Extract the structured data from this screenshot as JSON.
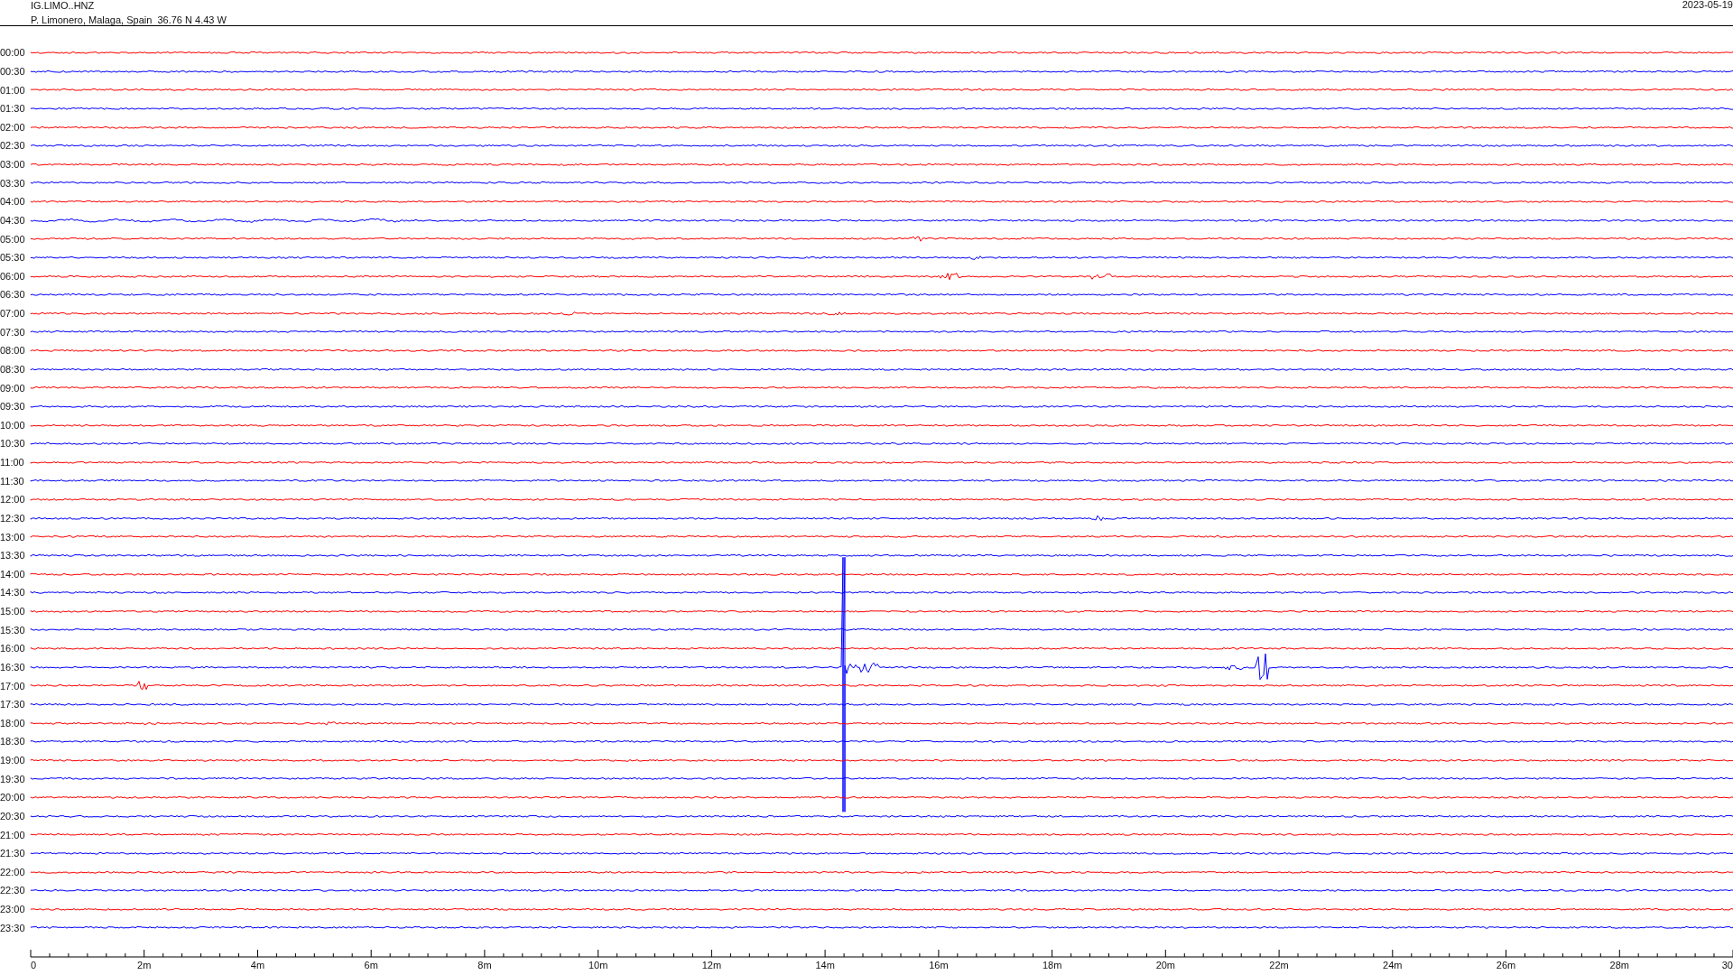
{
  "header": {
    "station": "IG.LIMO..HNZ",
    "location": "P. Limonero, Malaga, Spain  36.76 N 4.43 W",
    "date": "2023-05-19"
  },
  "rows": [
    {
      "time": "00:00",
      "color": "#ff0000"
    },
    {
      "time": "00:30",
      "color": "#0000ff"
    },
    {
      "time": "01:00",
      "color": "#ff0000"
    },
    {
      "time": "01:30",
      "color": "#0000ff"
    },
    {
      "time": "02:00",
      "color": "#ff0000"
    },
    {
      "time": "02:30",
      "color": "#0000ff"
    },
    {
      "time": "03:00",
      "color": "#ff0000"
    },
    {
      "time": "03:30",
      "color": "#0000ff"
    },
    {
      "time": "04:00",
      "color": "#ff0000"
    },
    {
      "time": "04:30",
      "color": "#0000ff"
    },
    {
      "time": "05:00",
      "color": "#ff0000"
    },
    {
      "time": "05:30",
      "color": "#0000ff"
    },
    {
      "time": "06:00",
      "color": "#ff0000"
    },
    {
      "time": "06:30",
      "color": "#0000ff"
    },
    {
      "time": "07:00",
      "color": "#ff0000"
    },
    {
      "time": "07:30",
      "color": "#0000ff"
    },
    {
      "time": "08:00",
      "color": "#ff0000"
    },
    {
      "time": "08:30",
      "color": "#0000ff"
    },
    {
      "time": "09:00",
      "color": "#ff0000"
    },
    {
      "time": "09:30",
      "color": "#0000ff"
    },
    {
      "time": "10:00",
      "color": "#ff0000"
    },
    {
      "time": "10:30",
      "color": "#0000ff"
    },
    {
      "time": "11:00",
      "color": "#ff0000"
    },
    {
      "time": "11:30",
      "color": "#0000ff"
    },
    {
      "time": "12:00",
      "color": "#ff0000"
    },
    {
      "time": "12:30",
      "color": "#0000ff"
    },
    {
      "time": "13:00",
      "color": "#ff0000"
    },
    {
      "time": "13:30",
      "color": "#0000ff"
    },
    {
      "time": "14:00",
      "color": "#ff0000"
    },
    {
      "time": "14:30",
      "color": "#0000ff"
    },
    {
      "time": "15:00",
      "color": "#ff0000"
    },
    {
      "time": "15:30",
      "color": "#0000ff"
    },
    {
      "time": "16:00",
      "color": "#ff0000"
    },
    {
      "time": "16:30",
      "color": "#0000ff"
    },
    {
      "time": "17:00",
      "color": "#ff0000"
    },
    {
      "time": "17:30",
      "color": "#0000ff"
    },
    {
      "time": "18:00",
      "color": "#ff0000"
    },
    {
      "time": "18:30",
      "color": "#0000ff"
    },
    {
      "time": "19:00",
      "color": "#ff0000"
    },
    {
      "time": "19:30",
      "color": "#0000ff"
    },
    {
      "time": "20:00",
      "color": "#ff0000"
    },
    {
      "time": "20:30",
      "color": "#0000ff"
    },
    {
      "time": "21:00",
      "color": "#ff0000"
    },
    {
      "time": "21:30",
      "color": "#0000ff"
    },
    {
      "time": "22:00",
      "color": "#ff0000"
    },
    {
      "time": "22:30",
      "color": "#0000ff"
    },
    {
      "time": "23:00",
      "color": "#ff0000"
    },
    {
      "time": "23:30",
      "color": "#0000ff"
    }
  ],
  "x_axis": {
    "ticks": [
      "0",
      "2m",
      "4m",
      "6m",
      "8m",
      "10m",
      "12m",
      "14m",
      "16m",
      "18m",
      "20m",
      "22m",
      "24m",
      "26m",
      "28m",
      "30"
    ]
  }
}
